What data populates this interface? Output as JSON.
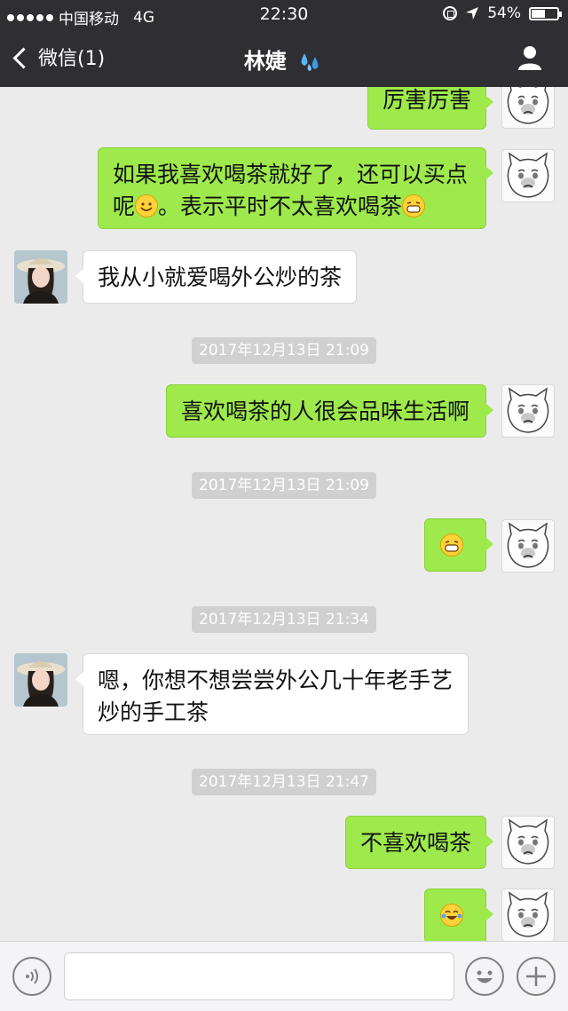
{
  "status_bar": {
    "carrier": "中国移动",
    "network": "4G",
    "time": "22:30",
    "battery": "54%",
    "battery_level": 0.54
  },
  "nav": {
    "back_label": "微信(1)",
    "title": "林婕",
    "title_emoji": "sweat-droplets-icon",
    "right_icon": "profile-icon"
  },
  "messages": [
    {
      "side": "out",
      "text": "厉害厉害"
    },
    {
      "side": "out",
      "line1": "如果我喜欢喝茶就好了，还可以买点",
      "line2_a": "呢",
      "line2_b": "。表示平时不太喜欢喝茶",
      "emojis": [
        "smile-emoji-icon",
        "grin-emoji-icon"
      ]
    },
    {
      "side": "in",
      "text": "我从小就爱喝外公炒的茶"
    },
    {
      "timestamp": "2017年12月13日 21:09"
    },
    {
      "side": "out",
      "text": "喜欢喝茶的人很会品味生活啊"
    },
    {
      "timestamp": "2017年12月13日 21:09"
    },
    {
      "side": "out",
      "emoji": "grin-emoji-icon"
    },
    {
      "timestamp": "2017年12月13日 21:34"
    },
    {
      "side": "in",
      "line1": "嗯，你想不想尝尝外公几十年老手艺",
      "line2": "炒的手工茶"
    },
    {
      "timestamp": "2017年12月13日 21:47"
    },
    {
      "side": "out",
      "text": "不喜欢喝茶"
    },
    {
      "side": "out",
      "emoji": "tears-of-joy-emoji-icon"
    }
  ],
  "input_bar": {
    "voice_icon": "voice-icon",
    "emoji_icon": "emoji-icon",
    "add_icon": "plus-icon",
    "input_value": ""
  },
  "colors": {
    "nav_bg": "#2e2e33",
    "outgoing_bubble": "#9ee94b",
    "incoming_bubble": "#ffffff",
    "chat_bg": "#ebebeb"
  }
}
